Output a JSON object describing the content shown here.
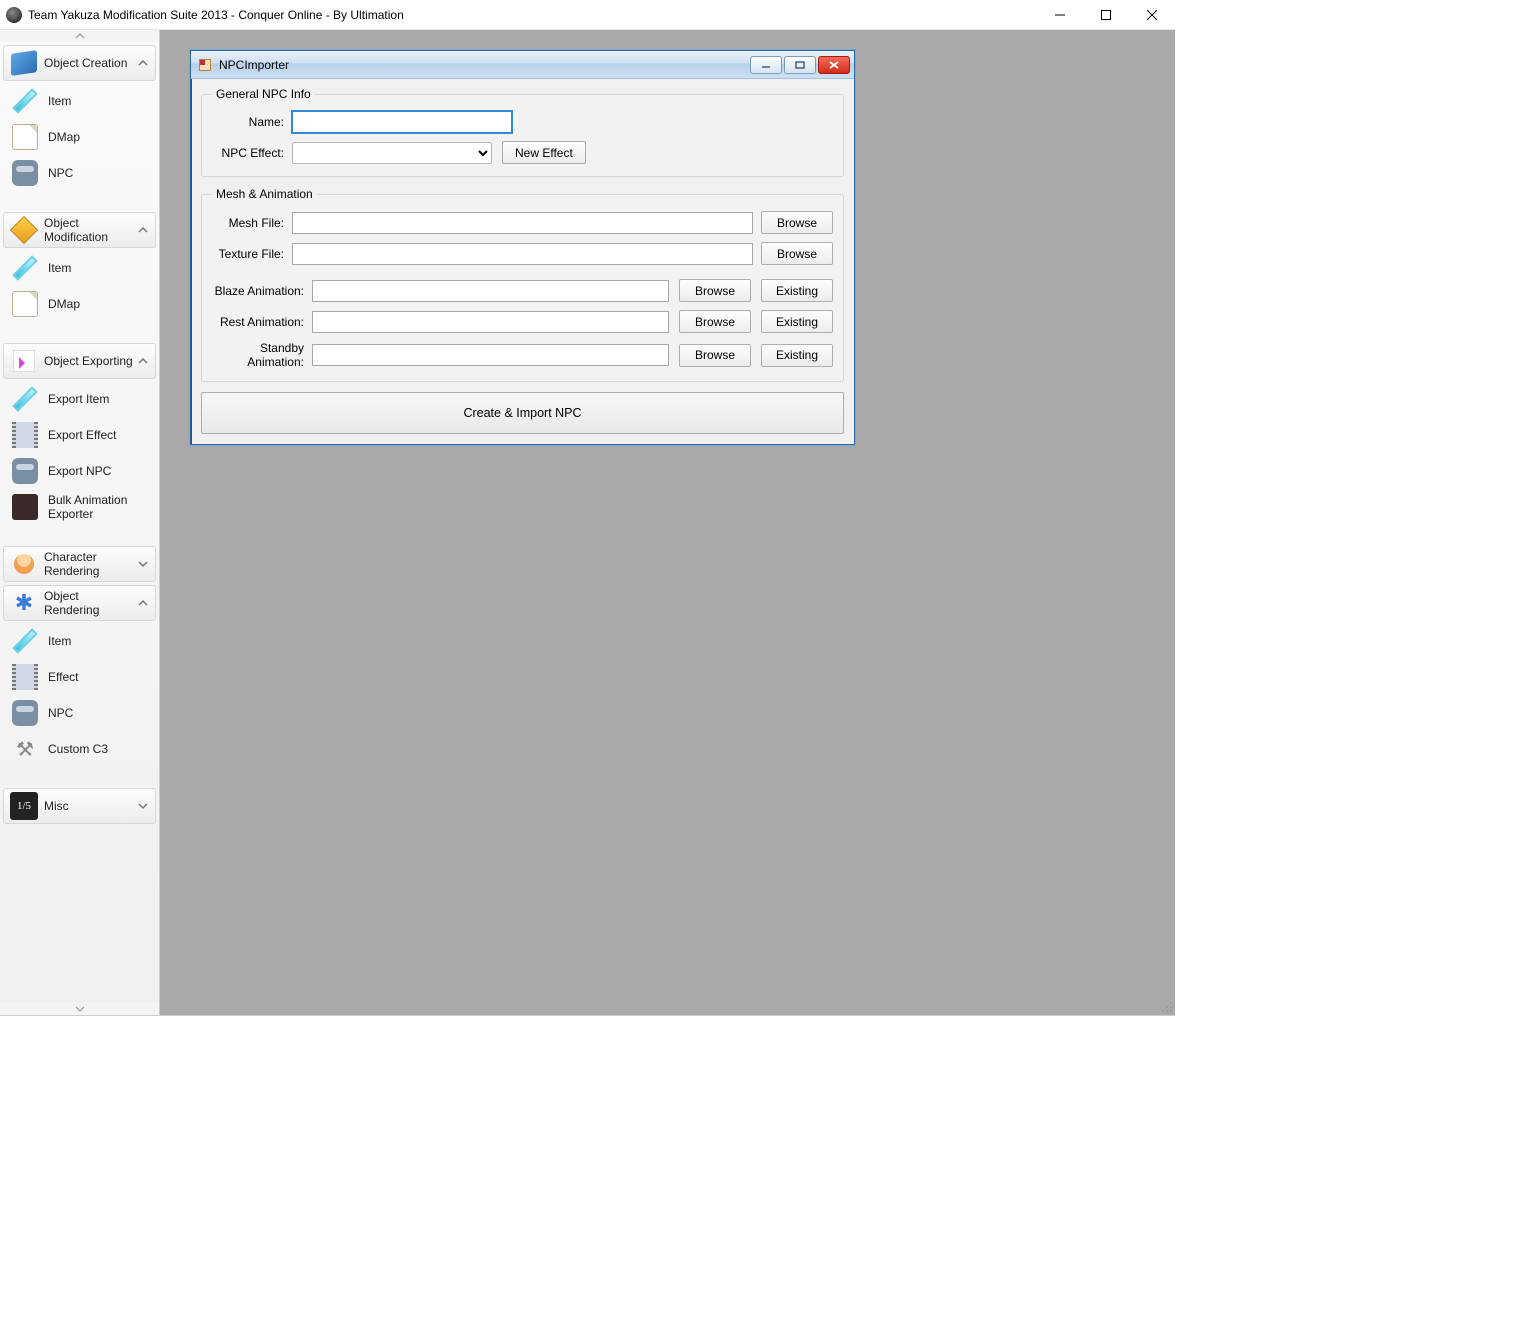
{
  "app": {
    "title": "Team Yakuza Modification Suite 2013 - Conquer Online - By Ultimation"
  },
  "sidebar": {
    "groups": [
      {
        "label": "Object Creation",
        "expanded": true,
        "items": [
          {
            "label": "Item"
          },
          {
            "label": "DMap"
          },
          {
            "label": "NPC"
          }
        ]
      },
      {
        "label": "Object Modification",
        "expanded": true,
        "items": [
          {
            "label": "Item"
          },
          {
            "label": "DMap"
          }
        ]
      },
      {
        "label": "Object Exporting",
        "expanded": true,
        "items": [
          {
            "label": "Export Item"
          },
          {
            "label": "Export Effect"
          },
          {
            "label": "Export NPC"
          },
          {
            "label": "Bulk Animation Exporter"
          }
        ]
      },
      {
        "label": "Character Rendering",
        "expanded": false,
        "items": []
      },
      {
        "label": "Object Rendering",
        "expanded": true,
        "items": [
          {
            "label": "Item"
          },
          {
            "label": "Effect"
          },
          {
            "label": "NPC"
          },
          {
            "label": "Custom C3"
          }
        ]
      },
      {
        "label": "Misc",
        "expanded": false,
        "items": []
      }
    ]
  },
  "dialog": {
    "title": "NPCImporter",
    "group_general": {
      "legend": "General NPC Info",
      "name_label": "Name:",
      "name_value": "",
      "npc_effect_label": "NPC Effect:",
      "npc_effect_value": "",
      "new_effect_btn": "New Effect"
    },
    "group_mesh": {
      "legend": "Mesh & Animation",
      "mesh_file_label": "Mesh File:",
      "mesh_file_value": "",
      "texture_file_label": "Texture File:",
      "texture_file_value": "",
      "browse_btn": "Browse",
      "existing_btn": "Existing",
      "blaze_label": "Blaze Animation:",
      "blaze_value": "",
      "rest_label": "Rest Animation:",
      "rest_value": "",
      "standby_label": "Standby Animation:",
      "standby_value": ""
    },
    "submit_btn": "Create & Import NPC"
  }
}
